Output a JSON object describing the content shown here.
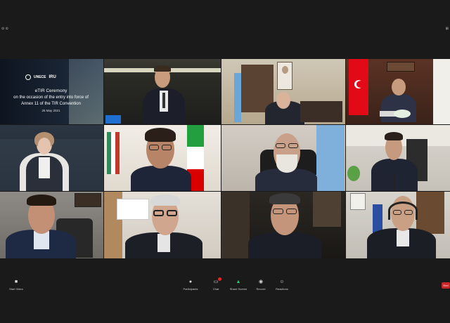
{
  "window": {
    "top_left_label": "⊙ ⊙",
    "top_right_label": "⊞"
  },
  "slide": {
    "logos": [
      "UNECE",
      "IRU"
    ],
    "title_line1": "eTIR Ceremony",
    "title_line2": "on the occasion of the entry into force of",
    "title_line3": "Annex 11 of the TIR Convention",
    "date": "25 May 2021"
  },
  "controls": {
    "unmute_label": "Start Video",
    "participants_label": "Participants",
    "chat_label": "Chat",
    "share_label": "Share Screen",
    "record_label": "Record",
    "reactions_label": "Reactions",
    "end_label": "End"
  },
  "colors": {
    "accent_green": "#2ecc71",
    "end_red": "#c62828"
  }
}
